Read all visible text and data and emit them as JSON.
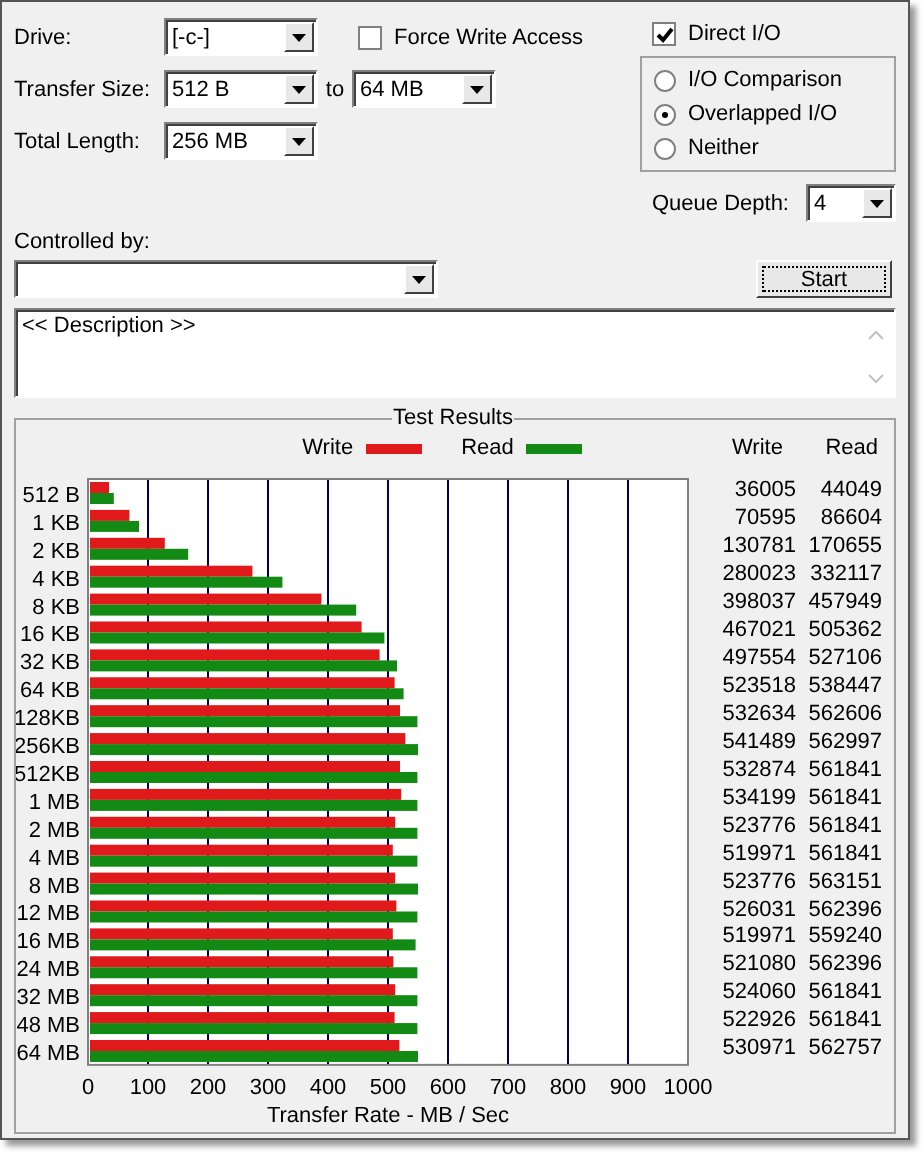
{
  "drive": {
    "label": "Drive:",
    "value": "[-c-]"
  },
  "force_write_access": {
    "label": "Force Write Access",
    "checked": false
  },
  "direct_io": {
    "label": "Direct I/O",
    "checked": true
  },
  "transfer_size": {
    "label": "Transfer Size:",
    "from": "512 B",
    "to_label": "to",
    "to": "64 MB"
  },
  "total_length": {
    "label": "Total Length:",
    "value": "256 MB"
  },
  "io_modes": [
    {
      "label": "I/O Comparison",
      "selected": false
    },
    {
      "label": "Overlapped I/O",
      "selected": true
    },
    {
      "label": "Neither",
      "selected": false
    }
  ],
  "queue_depth": {
    "label": "Queue Depth:",
    "value": "4"
  },
  "controlled_by": {
    "label": "Controlled by:"
  },
  "start_button": "Start",
  "description": "<< Description >>",
  "test_results": {
    "title": "Test Results",
    "chart_data": {
      "type": "bar",
      "orientation": "horizontal",
      "xlabel": "Transfer Rate - MB / Sec",
      "categories": [
        "512 B",
        "1 KB",
        "2 KB",
        "4 KB",
        "8 KB",
        "16 KB",
        "32 KB",
        "64 KB",
        "128KB",
        "256KB",
        "512KB",
        "1 MB",
        "2 MB",
        "4 MB",
        "8 MB",
        "12 MB",
        "16 MB",
        "24 MB",
        "32 MB",
        "48 MB",
        "64 MB"
      ],
      "series": [
        {
          "name": "Write",
          "color": "#e01a1a",
          "values": [
            35,
            69,
            128,
            274,
            389,
            456,
            486,
            511,
            520,
            529,
            520,
            522,
            512,
            508,
            512,
            514,
            508,
            509,
            512,
            511,
            519
          ]
        },
        {
          "name": "Read",
          "color": "#138a13",
          "values": [
            43,
            85,
            167,
            324,
            447,
            494,
            515,
            526,
            549,
            550,
            549,
            549,
            549,
            549,
            550,
            549,
            546,
            549,
            549,
            549,
            550
          ]
        }
      ],
      "grid": true,
      "xlim": [
        0,
        1000
      ],
      "xticks": [
        0,
        100,
        200,
        300,
        400,
        500,
        600,
        700,
        800,
        900,
        1000
      ]
    },
    "table": {
      "columns": [
        "Write",
        "Read"
      ],
      "rows": [
        [
          "36005",
          "44049"
        ],
        [
          "70595",
          "86604"
        ],
        [
          "130781",
          "170655"
        ],
        [
          "280023",
          "332117"
        ],
        [
          "398037",
          "457949"
        ],
        [
          "467021",
          "505362"
        ],
        [
          "497554",
          "527106"
        ],
        [
          "523518",
          "538447"
        ],
        [
          "532634",
          "562606"
        ],
        [
          "541489",
          "562997"
        ],
        [
          "532874",
          "561841"
        ],
        [
          "534199",
          "561841"
        ],
        [
          "523776",
          "561841"
        ],
        [
          "519971",
          "561841"
        ],
        [
          "523776",
          "563151"
        ],
        [
          "526031",
          "562396"
        ],
        [
          "519971",
          "559240"
        ],
        [
          "521080",
          "562396"
        ],
        [
          "524060",
          "561841"
        ],
        [
          "522926",
          "561841"
        ],
        [
          "530971",
          "562757"
        ]
      ]
    }
  }
}
